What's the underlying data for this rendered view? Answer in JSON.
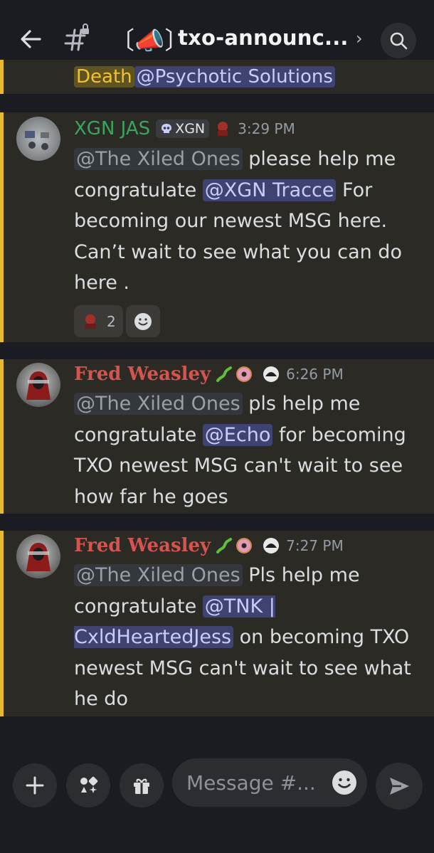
{
  "header": {
    "channel_emoji": "〔📣〕",
    "channel_name": "txo-announc...",
    "chevron": "›",
    "icons": {
      "back": "arrow-left-icon",
      "channel": "hash-lock-icon",
      "search": "search-icon"
    }
  },
  "messages": [
    {
      "partial": true,
      "mentions": [
        "Death",
        "@Psychotic Solutions"
      ]
    },
    {
      "author": "XGN JAS",
      "author_color": "#3ba55d",
      "tag": {
        "icon": "skull-icon",
        "label": "XGN"
      },
      "role_icon": "role-badge-icon",
      "time": "3:29 PM",
      "segments": [
        {
          "type": "role",
          "text": "@The Xiled Ones"
        },
        {
          "type": "text",
          "text": " please help me congratulate "
        },
        {
          "type": "user",
          "text": "@XGN Tracce"
        },
        {
          "type": "text",
          "text": " For becoming our newest MSG here. Can’t wait to see what you can do here ."
        }
      ],
      "reactions": [
        {
          "icon": "custom-emoji-icon",
          "count": "2"
        },
        {
          "icon": "add-reaction-icon",
          "count": ""
        }
      ]
    },
    {
      "author": "Fred Weasley",
      "author_color": "#d6534f",
      "author_icons": [
        "lizard-emoji",
        "donut-emoji"
      ],
      "role_icon": "role-badge-icon",
      "time": "6:26 PM",
      "segments": [
        {
          "type": "role",
          "text": "@The Xiled Ones"
        },
        {
          "type": "text",
          "text": " pls help me congratulate "
        },
        {
          "type": "user",
          "text": "@Echo"
        },
        {
          "type": "text",
          "text": " for becoming TXO newest MSG can't wait to see how far he goes"
        }
      ]
    },
    {
      "author": "Fred Weasley",
      "author_color": "#d6534f",
      "author_icons": [
        "lizard-emoji",
        "donut-emoji"
      ],
      "role_icon": "role-badge-icon",
      "time": "7:27 PM",
      "segments": [
        {
          "type": "role",
          "text": "@The Xiled Ones"
        },
        {
          "type": "text",
          "text": " Pls help me congratulate "
        },
        {
          "type": "user",
          "text": "@TNK | CxldHeartedJess"
        },
        {
          "type": "text",
          "text": " on becoming TXO newest MSG can't wait to see what he do"
        }
      ]
    }
  ],
  "composer": {
    "placeholder": "Message #...",
    "buttons": [
      "plus-icon",
      "apps-icon",
      "gift-icon",
      "emoji-icon",
      "send-icon"
    ]
  },
  "colors": {
    "background": "#1b1c21",
    "highlight_bg": "#2c2a24",
    "highlight_bar": "#e7b830",
    "mention_bg": "#3e4372",
    "mention_fg": "#c9cdfb"
  }
}
